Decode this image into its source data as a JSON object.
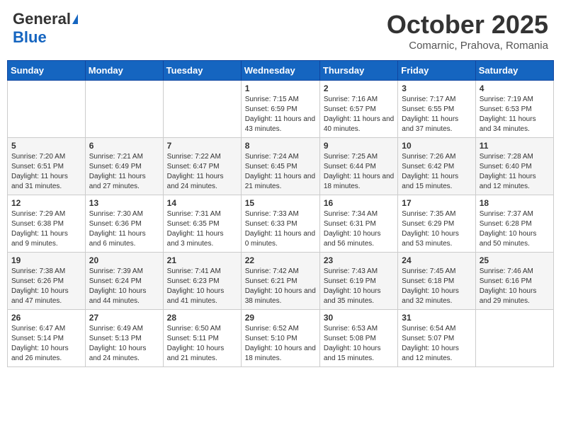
{
  "header": {
    "logo_general": "General",
    "logo_blue": "Blue",
    "month": "October 2025",
    "location": "Comarnic, Prahova, Romania"
  },
  "weekdays": [
    "Sunday",
    "Monday",
    "Tuesday",
    "Wednesday",
    "Thursday",
    "Friday",
    "Saturday"
  ],
  "weeks": [
    [
      {
        "day": "",
        "info": ""
      },
      {
        "day": "",
        "info": ""
      },
      {
        "day": "",
        "info": ""
      },
      {
        "day": "1",
        "info": "Sunrise: 7:15 AM\nSunset: 6:59 PM\nDaylight: 11 hours and 43 minutes."
      },
      {
        "day": "2",
        "info": "Sunrise: 7:16 AM\nSunset: 6:57 PM\nDaylight: 11 hours and 40 minutes."
      },
      {
        "day": "3",
        "info": "Sunrise: 7:17 AM\nSunset: 6:55 PM\nDaylight: 11 hours and 37 minutes."
      },
      {
        "day": "4",
        "info": "Sunrise: 7:19 AM\nSunset: 6:53 PM\nDaylight: 11 hours and 34 minutes."
      }
    ],
    [
      {
        "day": "5",
        "info": "Sunrise: 7:20 AM\nSunset: 6:51 PM\nDaylight: 11 hours and 31 minutes."
      },
      {
        "day": "6",
        "info": "Sunrise: 7:21 AM\nSunset: 6:49 PM\nDaylight: 11 hours and 27 minutes."
      },
      {
        "day": "7",
        "info": "Sunrise: 7:22 AM\nSunset: 6:47 PM\nDaylight: 11 hours and 24 minutes."
      },
      {
        "day": "8",
        "info": "Sunrise: 7:24 AM\nSunset: 6:45 PM\nDaylight: 11 hours and 21 minutes."
      },
      {
        "day": "9",
        "info": "Sunrise: 7:25 AM\nSunset: 6:44 PM\nDaylight: 11 hours and 18 minutes."
      },
      {
        "day": "10",
        "info": "Sunrise: 7:26 AM\nSunset: 6:42 PM\nDaylight: 11 hours and 15 minutes."
      },
      {
        "day": "11",
        "info": "Sunrise: 7:28 AM\nSunset: 6:40 PM\nDaylight: 11 hours and 12 minutes."
      }
    ],
    [
      {
        "day": "12",
        "info": "Sunrise: 7:29 AM\nSunset: 6:38 PM\nDaylight: 11 hours and 9 minutes."
      },
      {
        "day": "13",
        "info": "Sunrise: 7:30 AM\nSunset: 6:36 PM\nDaylight: 11 hours and 6 minutes."
      },
      {
        "day": "14",
        "info": "Sunrise: 7:31 AM\nSunset: 6:35 PM\nDaylight: 11 hours and 3 minutes."
      },
      {
        "day": "15",
        "info": "Sunrise: 7:33 AM\nSunset: 6:33 PM\nDaylight: 11 hours and 0 minutes."
      },
      {
        "day": "16",
        "info": "Sunrise: 7:34 AM\nSunset: 6:31 PM\nDaylight: 10 hours and 56 minutes."
      },
      {
        "day": "17",
        "info": "Sunrise: 7:35 AM\nSunset: 6:29 PM\nDaylight: 10 hours and 53 minutes."
      },
      {
        "day": "18",
        "info": "Sunrise: 7:37 AM\nSunset: 6:28 PM\nDaylight: 10 hours and 50 minutes."
      }
    ],
    [
      {
        "day": "19",
        "info": "Sunrise: 7:38 AM\nSunset: 6:26 PM\nDaylight: 10 hours and 47 minutes."
      },
      {
        "day": "20",
        "info": "Sunrise: 7:39 AM\nSunset: 6:24 PM\nDaylight: 10 hours and 44 minutes."
      },
      {
        "day": "21",
        "info": "Sunrise: 7:41 AM\nSunset: 6:23 PM\nDaylight: 10 hours and 41 minutes."
      },
      {
        "day": "22",
        "info": "Sunrise: 7:42 AM\nSunset: 6:21 PM\nDaylight: 10 hours and 38 minutes."
      },
      {
        "day": "23",
        "info": "Sunrise: 7:43 AM\nSunset: 6:19 PM\nDaylight: 10 hours and 35 minutes."
      },
      {
        "day": "24",
        "info": "Sunrise: 7:45 AM\nSunset: 6:18 PM\nDaylight: 10 hours and 32 minutes."
      },
      {
        "day": "25",
        "info": "Sunrise: 7:46 AM\nSunset: 6:16 PM\nDaylight: 10 hours and 29 minutes."
      }
    ],
    [
      {
        "day": "26",
        "info": "Sunrise: 6:47 AM\nSunset: 5:14 PM\nDaylight: 10 hours and 26 minutes."
      },
      {
        "day": "27",
        "info": "Sunrise: 6:49 AM\nSunset: 5:13 PM\nDaylight: 10 hours and 24 minutes."
      },
      {
        "day": "28",
        "info": "Sunrise: 6:50 AM\nSunset: 5:11 PM\nDaylight: 10 hours and 21 minutes."
      },
      {
        "day": "29",
        "info": "Sunrise: 6:52 AM\nSunset: 5:10 PM\nDaylight: 10 hours and 18 minutes."
      },
      {
        "day": "30",
        "info": "Sunrise: 6:53 AM\nSunset: 5:08 PM\nDaylight: 10 hours and 15 minutes."
      },
      {
        "day": "31",
        "info": "Sunrise: 6:54 AM\nSunset: 5:07 PM\nDaylight: 10 hours and 12 minutes."
      },
      {
        "day": "",
        "info": ""
      }
    ]
  ]
}
